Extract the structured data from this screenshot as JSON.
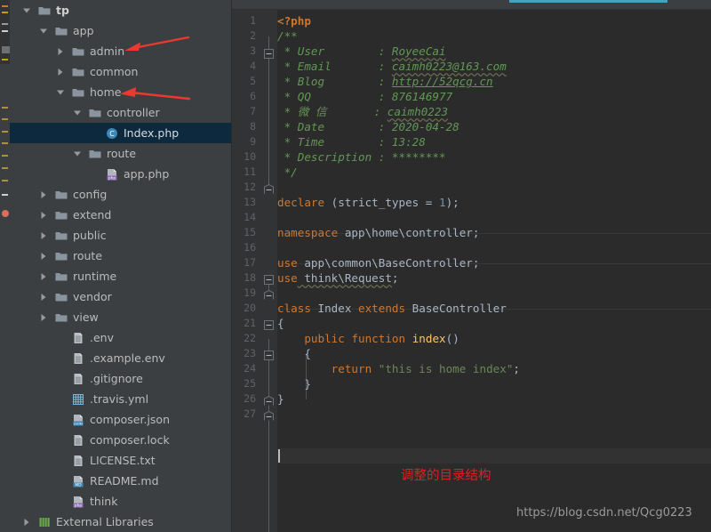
{
  "window": {
    "accent_color": "#4a9fc4",
    "sidebar_bg": "#3c3f41",
    "editor_bg": "#2b2b2b",
    "selection_bg": "#0d293e"
  },
  "project_tree": {
    "root": {
      "name": "tp",
      "path": "G:\\phpstudy2019\\WWW\\tp"
    },
    "items": [
      {
        "label": "tp",
        "path": "G:\\phpstudy2019\\WWW\\tp",
        "depth": 0,
        "arrow": "down",
        "icon": "folder-icon",
        "bold": true,
        "selected": false
      },
      {
        "label": "app",
        "path": "",
        "depth": 1,
        "arrow": "down",
        "icon": "folder-icon",
        "bold": false,
        "selected": false
      },
      {
        "label": "admin",
        "path": "",
        "depth": 2,
        "arrow": "right",
        "icon": "folder-icon",
        "bold": false,
        "selected": false
      },
      {
        "label": "common",
        "path": "",
        "depth": 2,
        "arrow": "right",
        "icon": "folder-icon",
        "bold": false,
        "selected": false
      },
      {
        "label": "home",
        "path": "",
        "depth": 2,
        "arrow": "down",
        "icon": "folder-icon",
        "bold": false,
        "selected": false
      },
      {
        "label": "controller",
        "path": "",
        "depth": 3,
        "arrow": "down",
        "icon": "folder-icon",
        "bold": false,
        "selected": false
      },
      {
        "label": "Index.php",
        "path": "",
        "depth": 4,
        "arrow": "none",
        "icon": "php-class-icon",
        "bold": false,
        "selected": true
      },
      {
        "label": "route",
        "path": "",
        "depth": 3,
        "arrow": "down",
        "icon": "folder-icon",
        "bold": false,
        "selected": false
      },
      {
        "label": "app.php",
        "path": "",
        "depth": 4,
        "arrow": "none",
        "icon": "php-file-icon",
        "bold": false,
        "selected": false
      },
      {
        "label": "config",
        "path": "",
        "depth": 1,
        "arrow": "right",
        "icon": "folder-icon",
        "bold": false,
        "selected": false
      },
      {
        "label": "extend",
        "path": "",
        "depth": 1,
        "arrow": "right",
        "icon": "folder-icon",
        "bold": false,
        "selected": false
      },
      {
        "label": "public",
        "path": "",
        "depth": 1,
        "arrow": "right",
        "icon": "folder-icon",
        "bold": false,
        "selected": false
      },
      {
        "label": "route",
        "path": "",
        "depth": 1,
        "arrow": "right",
        "icon": "folder-icon",
        "bold": false,
        "selected": false
      },
      {
        "label": "runtime",
        "path": "",
        "depth": 1,
        "arrow": "right",
        "icon": "folder-icon",
        "bold": false,
        "selected": false
      },
      {
        "label": "vendor",
        "path": "",
        "depth": 1,
        "arrow": "right",
        "icon": "folder-icon",
        "bold": false,
        "selected": false
      },
      {
        "label": "view",
        "path": "",
        "depth": 1,
        "arrow": "right",
        "icon": "folder-icon",
        "bold": false,
        "selected": false
      },
      {
        "label": ".env",
        "path": "",
        "depth": 2,
        "arrow": "none",
        "icon": "text-file-icon",
        "bold": false,
        "selected": false
      },
      {
        "label": ".example.env",
        "path": "",
        "depth": 2,
        "arrow": "none",
        "icon": "text-file-icon",
        "bold": false,
        "selected": false
      },
      {
        "label": ".gitignore",
        "path": "",
        "depth": 2,
        "arrow": "none",
        "icon": "text-file-icon",
        "bold": false,
        "selected": false
      },
      {
        "label": ".travis.yml",
        "path": "",
        "depth": 2,
        "arrow": "none",
        "icon": "yaml-file-icon",
        "bold": false,
        "selected": false
      },
      {
        "label": "composer.json",
        "path": "",
        "depth": 2,
        "arrow": "none",
        "icon": "json-file-icon",
        "bold": false,
        "selected": false
      },
      {
        "label": "composer.lock",
        "path": "",
        "depth": 2,
        "arrow": "none",
        "icon": "text-file-icon",
        "bold": false,
        "selected": false
      },
      {
        "label": "LICENSE.txt",
        "path": "",
        "depth": 2,
        "arrow": "none",
        "icon": "text-file-icon",
        "bold": false,
        "selected": false
      },
      {
        "label": "README.md",
        "path": "",
        "depth": 2,
        "arrow": "none",
        "icon": "markdown-file-icon",
        "bold": false,
        "selected": false
      },
      {
        "label": "think",
        "path": "",
        "depth": 2,
        "arrow": "none",
        "icon": "php-file-icon",
        "bold": false,
        "selected": false
      },
      {
        "label": "External Libraries",
        "path": "",
        "depth": 0,
        "arrow": "right",
        "icon": "libraries-icon",
        "bold": false,
        "selected": false
      }
    ]
  },
  "editor": {
    "language": "php",
    "caret_line": 27,
    "current_line": 27,
    "line_numbers": [
      1,
      2,
      3,
      4,
      5,
      6,
      7,
      8,
      9,
      10,
      11,
      12,
      13,
      14,
      15,
      16,
      17,
      18,
      19,
      20,
      21,
      22,
      23,
      24,
      25,
      26,
      27
    ],
    "lines": [
      {
        "n": 1,
        "text": "<?php"
      },
      {
        "n": 2,
        "text": "/**"
      },
      {
        "n": 3,
        "text": " * User        : RoyeeCai"
      },
      {
        "n": 4,
        "text": " * Email       : caimh0223@163.com"
      },
      {
        "n": 5,
        "text": " * Blog        : http://52qcg.cn"
      },
      {
        "n": 6,
        "text": " * QQ          : 876146977"
      },
      {
        "n": 7,
        "text": " * 微 信        : caimh0223"
      },
      {
        "n": 8,
        "text": " * Date        : 2020-04-28"
      },
      {
        "n": 9,
        "text": " * Time        : 13:28"
      },
      {
        "n": 10,
        "text": " * Description : ********"
      },
      {
        "n": 11,
        "text": " */"
      },
      {
        "n": 12,
        "text": ""
      },
      {
        "n": 13,
        "text": "declare (strict_types = 1);"
      },
      {
        "n": 14,
        "text": ""
      },
      {
        "n": 15,
        "text": "namespace app\\home\\controller;"
      },
      {
        "n": 16,
        "text": ""
      },
      {
        "n": 17,
        "text": "use app\\common\\BaseController;"
      },
      {
        "n": 18,
        "text": "use think\\Request;"
      },
      {
        "n": 19,
        "text": ""
      },
      {
        "n": 20,
        "text": "class Index extends BaseController"
      },
      {
        "n": 21,
        "text": "{"
      },
      {
        "n": 22,
        "text": "    public function index()"
      },
      {
        "n": 23,
        "text": "    {"
      },
      {
        "n": 24,
        "text": "        return \"this is home index\";"
      },
      {
        "n": 25,
        "text": "    }"
      },
      {
        "n": 26,
        "text": "}"
      },
      {
        "n": 27,
        "text": ""
      }
    ],
    "docblock": {
      "User": "RoyeeCai",
      "Email": "caimh0223@163.com",
      "Blog": "http://52qcg.cn",
      "QQ": "876146977",
      "WeChat_label": "微 信",
      "WeChat": "caimh0223",
      "Date": "2020-04-28",
      "Time": "13:28",
      "Description": "********"
    },
    "tokens": {
      "php_open": "<?php",
      "cmt_start": "/**",
      "cmt_end": " */",
      "declare_kw": "declare",
      "declare_rest": " (strict_types = ",
      "declare_num": "1",
      "declare_tail": ");",
      "namespace_kw": "namespace",
      "namespace_val": " app\\home\\controller;",
      "use_kw": "use",
      "use1_val": " app\\common\\BaseController;",
      "use2_val": " think\\Request",
      "use2_semi": ";",
      "class_kw": "class",
      "class_name": " Index ",
      "extends_kw": "extends",
      "class_parent": " BaseController",
      "brace_open": "{",
      "brace_close": "}",
      "public_kw": "public",
      "function_kw": "function",
      "fn_name": "index",
      "fn_parens": "()",
      "return_kw": "return",
      "return_str": "\"this is home index\"",
      "semicolon": ";",
      "indent4": "    ",
      "indent8": "        "
    }
  },
  "annotations": {
    "note_text": "调整的目录结构",
    "note_color": "#e02020",
    "arrows": [
      {
        "name": "arrow-to-admin",
        "color": "#e83a30"
      },
      {
        "name": "arrow-to-home",
        "color": "#e83a30"
      }
    ],
    "watermark": "https://blog.csdn.net/Qcg0223"
  }
}
